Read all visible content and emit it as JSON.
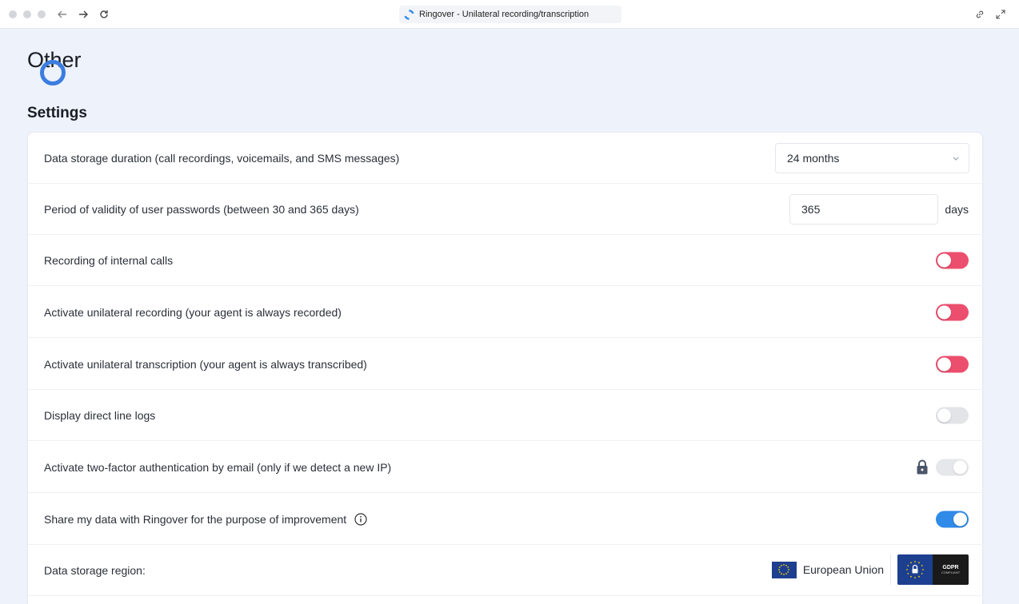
{
  "window": {
    "tab_title": "Ringover - Unilateral recording/transcription",
    "colors": {
      "brand": "#2f8ae8",
      "toggle_off": "#ec4f6e"
    }
  },
  "page": {
    "title": "Other",
    "section_title": "Settings"
  },
  "settings": {
    "storage_duration": {
      "label": "Data storage duration (call recordings, voicemails, and SMS messages)",
      "value": "24 months"
    },
    "password_validity": {
      "label": "Period of validity of user passwords (between 30 and 365 days)",
      "value": "365",
      "unit": "days"
    },
    "internal_calls": {
      "label": "Recording of internal calls",
      "state": "off"
    },
    "unilateral_recording": {
      "label": "Activate unilateral recording (your agent is always recorded)",
      "state": "off"
    },
    "unilateral_transcription": {
      "label": "Activate unilateral transcription (your agent is always transcribed)",
      "state": "off"
    },
    "direct_line_logs": {
      "label": "Display direct line logs",
      "state": "off"
    },
    "two_factor": {
      "label": "Activate two-factor authentication by email (only if we detect a new IP)",
      "state": "locked"
    },
    "share_data": {
      "label": "Share my data with Ringover for the purpose of improvement",
      "state": "on"
    },
    "storage_region": {
      "label": "Data storage region:",
      "region_name": "European Union",
      "badge_title": "GDPR",
      "badge_subtitle": "COMPLIANT"
    }
  }
}
